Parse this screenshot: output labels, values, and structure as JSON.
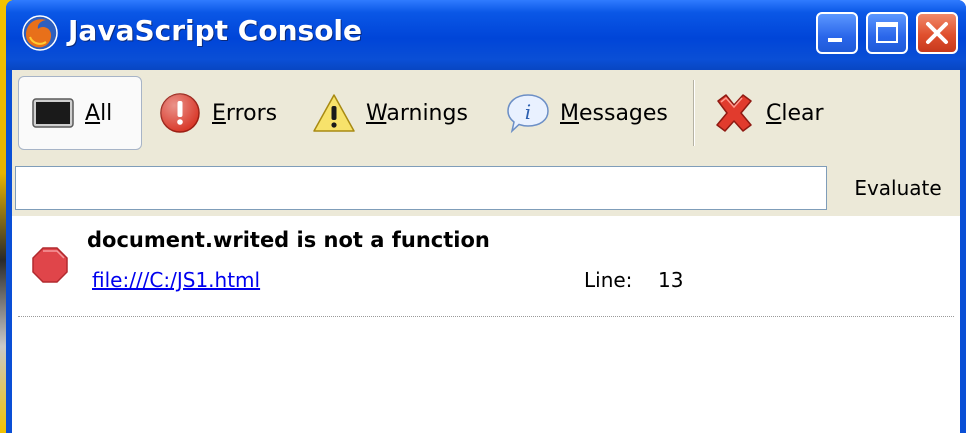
{
  "window": {
    "title": "JavaScript Console",
    "app_icon": "firefox-icon"
  },
  "toolbar": {
    "items": [
      {
        "key": "all",
        "label_access": "A",
        "label_rest": "ll",
        "icon": "console-icon",
        "active": true
      },
      {
        "key": "errors",
        "label_access": "E",
        "label_rest": "rrors",
        "icon": "error-icon",
        "active": false
      },
      {
        "key": "warnings",
        "label_access": "W",
        "label_rest": "arnings",
        "icon": "warning-icon",
        "active": false
      },
      {
        "key": "messages",
        "label_access": "M",
        "label_rest": "essages",
        "icon": "info-icon",
        "active": false
      },
      {
        "key": "clear",
        "label_access": "C",
        "label_rest": "lear",
        "icon": "clear-x-icon",
        "active": false
      }
    ]
  },
  "evaluate": {
    "input_value": "",
    "button_label": "Evaluate"
  },
  "log": [
    {
      "type": "error",
      "message": "document.writed is not a function",
      "file": "file:///C:/JS1.html",
      "line_label": "Line:",
      "line_number": "13"
    }
  ],
  "colors": {
    "titlebar_blue": "#0a4fd6",
    "toolbar_bg": "#ece9d8",
    "close_red": "#e0502e",
    "link_blue": "#0000ee",
    "error_red": "#e0454a"
  }
}
